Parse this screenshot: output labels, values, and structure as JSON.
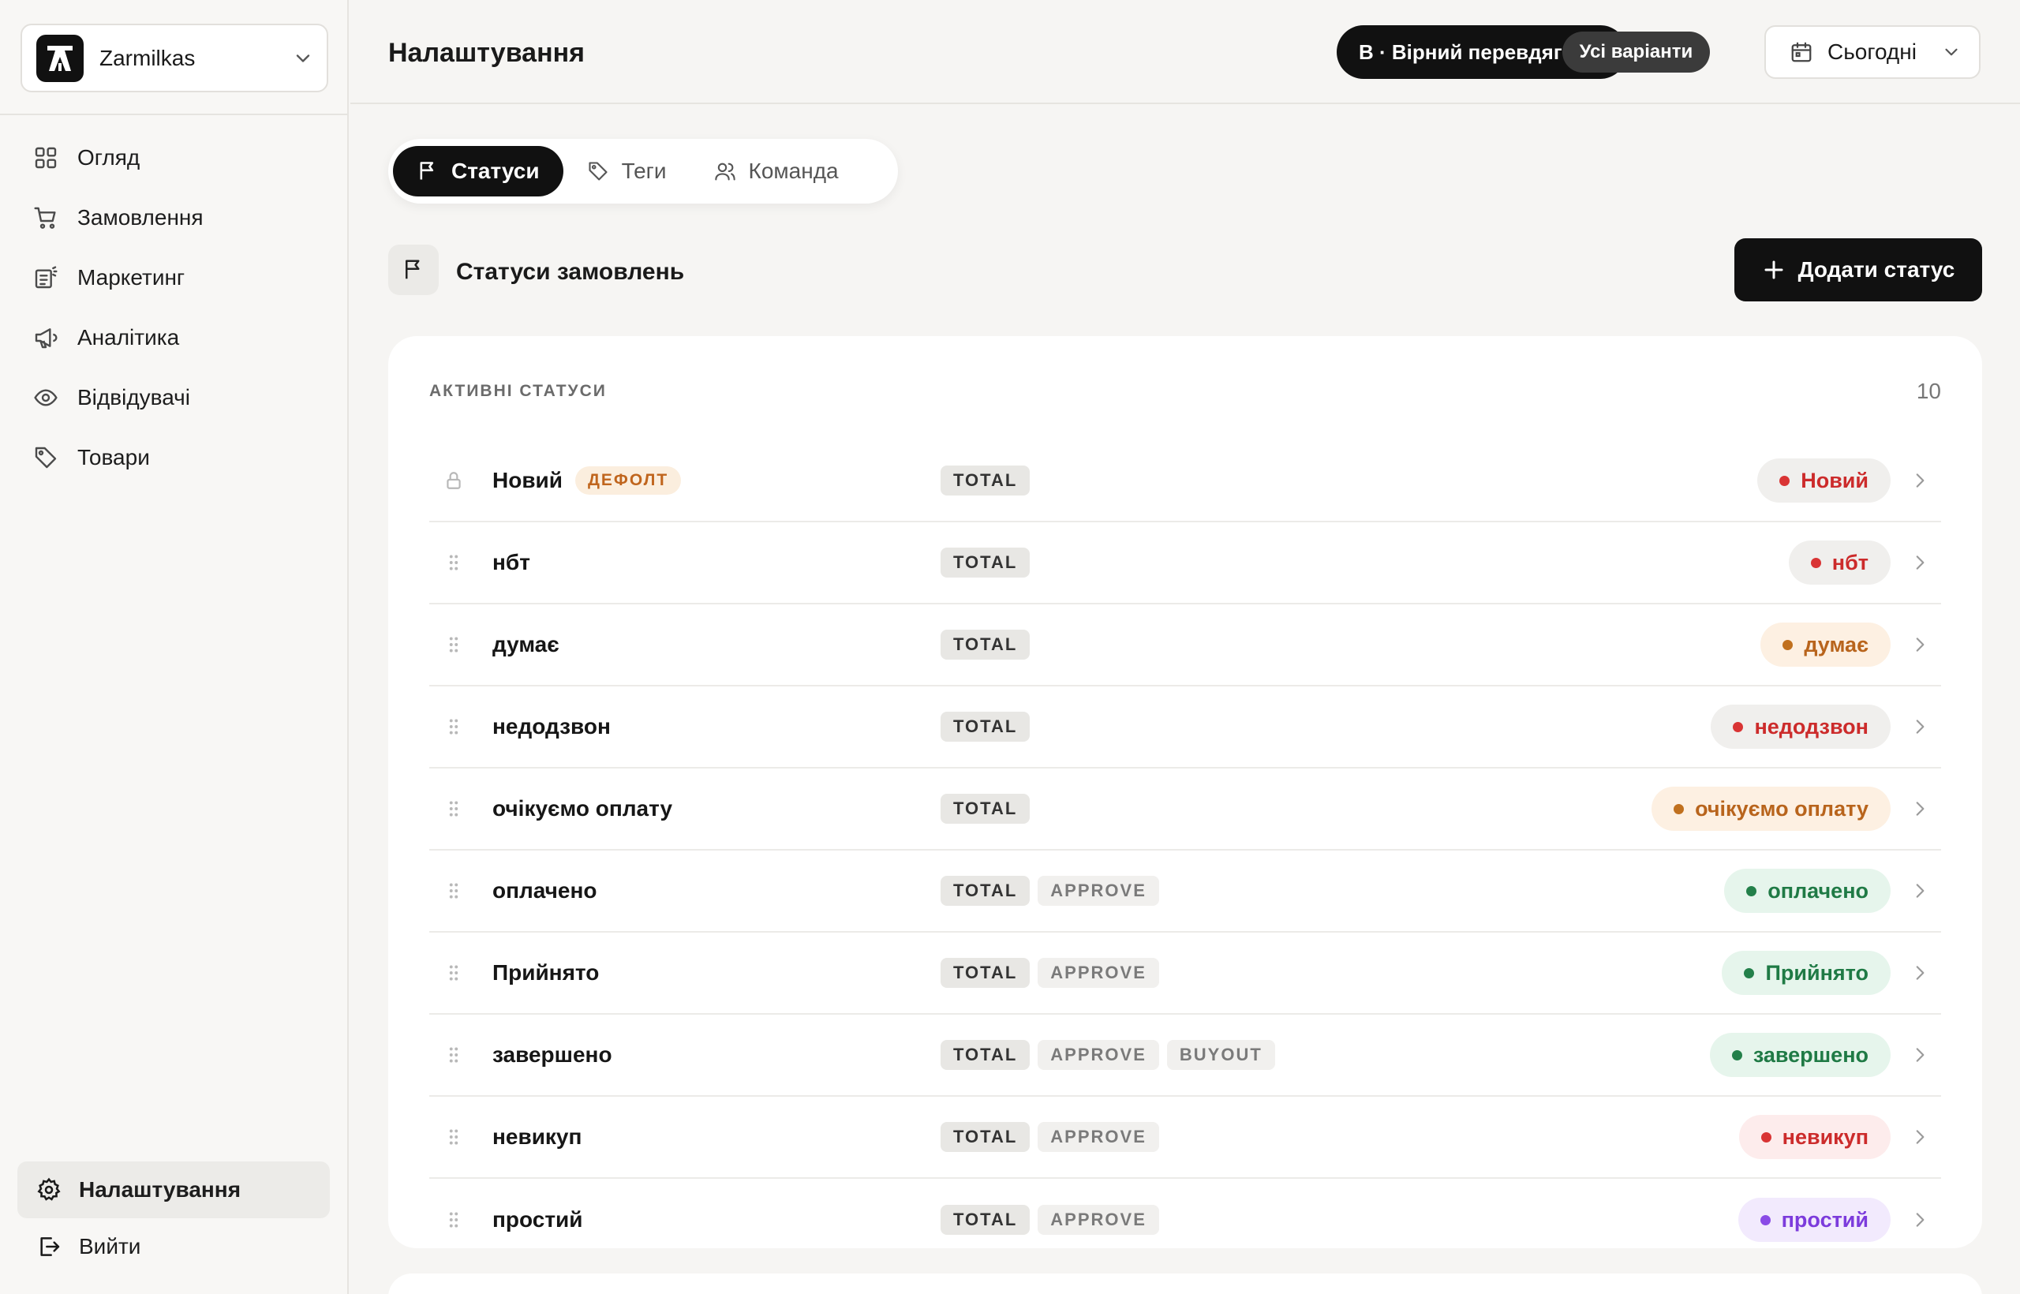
{
  "workspace": {
    "name": "Zarmilkas"
  },
  "nav": {
    "items": [
      {
        "label": "Огляд",
        "icon": "grid-icon"
      },
      {
        "label": "Замовлення",
        "icon": "cart-icon"
      },
      {
        "label": "Маркетинг",
        "icon": "marketing-icon"
      },
      {
        "label": "Аналітика",
        "icon": "megaphone-icon"
      },
      {
        "label": "Відвідувачі",
        "icon": "eye-icon"
      },
      {
        "label": "Товари",
        "icon": "tag-icon"
      }
    ],
    "settings": "Налаштування",
    "logout": "Вийти"
  },
  "header": {
    "title": "Налаштування",
    "variant_label": "В · Вірний перевдяг",
    "variant_button": "Усі варіанти",
    "date_label": "Сьогодні"
  },
  "tabs": [
    {
      "label": "Статуси",
      "active": true
    },
    {
      "label": "Теги",
      "active": false
    },
    {
      "label": "Команда",
      "active": false
    }
  ],
  "section": {
    "title": "Статуси замовлень",
    "add_button": "Додати статус"
  },
  "card": {
    "heading": "АКТИВНІ СТАТУСИ",
    "count": "10"
  },
  "colors": {
    "red": {
      "bg": "#fdecec",
      "fg": "#cc2b2b",
      "dot": "#d93434"
    },
    "gray": {
      "bg": "#f0efed",
      "fg": "#cc2b2b",
      "dot": "#d93434"
    },
    "orange": {
      "bg": "#fdf0e2",
      "fg": "#b8641c",
      "dot": "#c0701e"
    },
    "green": {
      "bg": "#e6f5ec",
      "fg": "#1f7a45",
      "dot": "#23804a"
    },
    "purple": {
      "bg": "#f2eafd",
      "fg": "#7c3bdc",
      "dot": "#8a4be6"
    }
  },
  "default_badge": "ДЕФОЛТ",
  "statuses": [
    {
      "name": "Новий",
      "default": true,
      "tags": [
        "TOTAL"
      ],
      "badge": "Новий",
      "color": "gray"
    },
    {
      "name": "нбт",
      "default": false,
      "tags": [
        "TOTAL"
      ],
      "badge": "нбт",
      "color": "gray"
    },
    {
      "name": "думає",
      "default": false,
      "tags": [
        "TOTAL"
      ],
      "badge": "думає",
      "color": "orange"
    },
    {
      "name": "недодзвон",
      "default": false,
      "tags": [
        "TOTAL"
      ],
      "badge": "недодзвон",
      "color": "gray"
    },
    {
      "name": "очікуємо оплату",
      "default": false,
      "tags": [
        "TOTAL"
      ],
      "badge": "очікуємо оплату",
      "color": "orange"
    },
    {
      "name": "оплачено",
      "default": false,
      "tags": [
        "TOTAL",
        "APPROVE"
      ],
      "badge": "оплачено",
      "color": "green"
    },
    {
      "name": "Прийнято",
      "default": false,
      "tags": [
        "TOTAL",
        "APPROVE"
      ],
      "badge": "Прийнято",
      "color": "green"
    },
    {
      "name": "завершено",
      "default": false,
      "tags": [
        "TOTAL",
        "APPROVE",
        "BUYOUT"
      ],
      "badge": "завершено",
      "color": "green"
    },
    {
      "name": "невикуп",
      "default": false,
      "tags": [
        "TOTAL",
        "APPROVE"
      ],
      "badge": "невикуп",
      "color": "red"
    },
    {
      "name": "простий",
      "default": false,
      "tags": [
        "TOTAL",
        "APPROVE"
      ],
      "badge": "простий",
      "color": "purple"
    }
  ]
}
